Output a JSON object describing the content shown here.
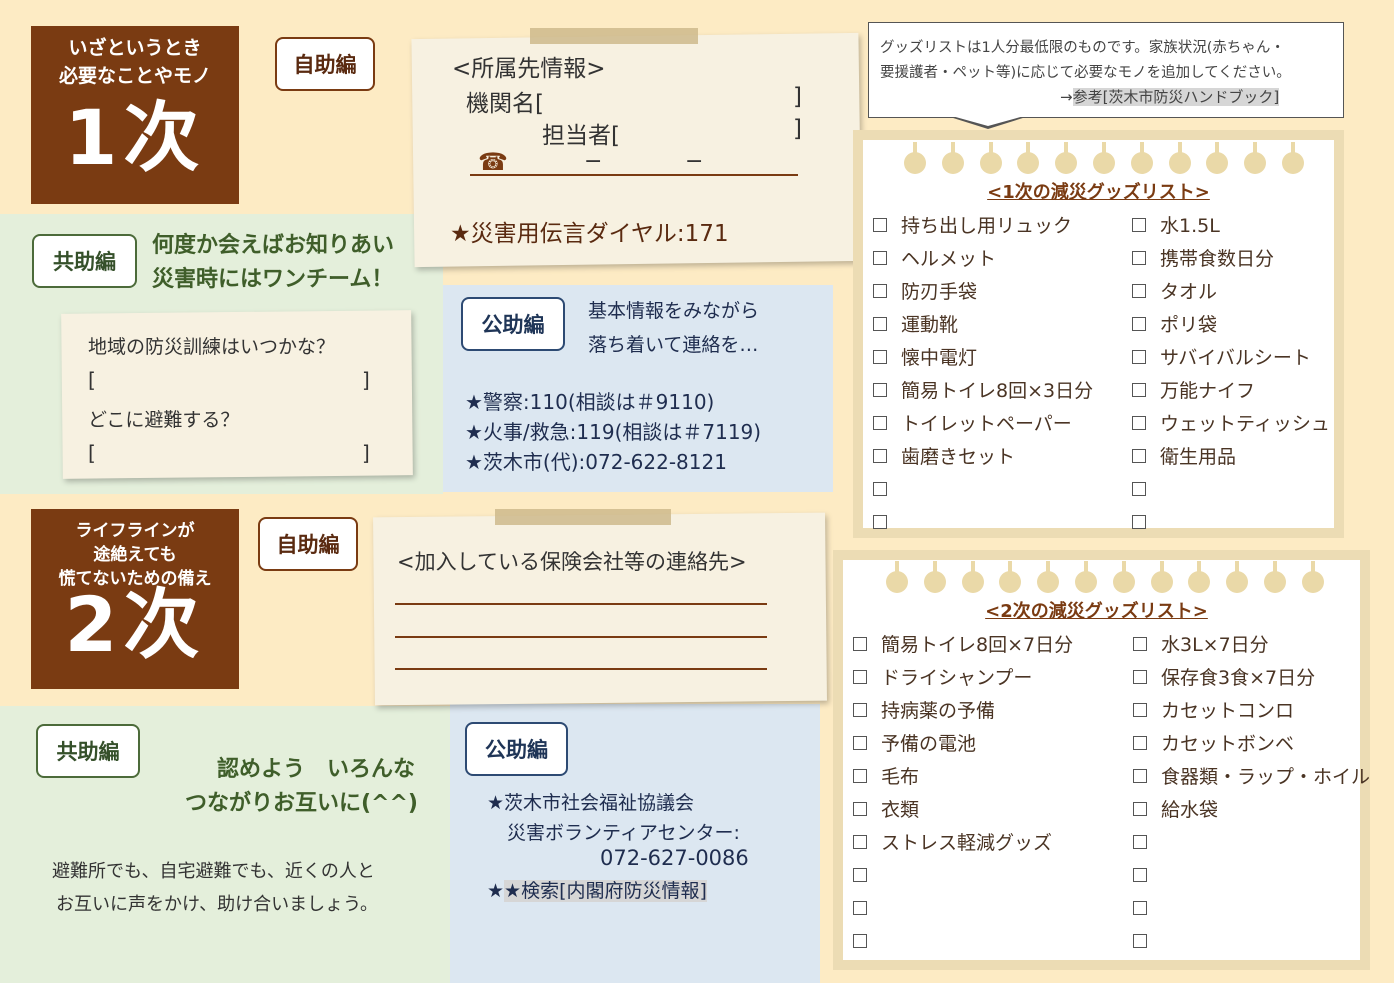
{
  "primary": {
    "heading_line1": "いざというとき",
    "heading_line2": "必要なことやモノ",
    "big": "1次",
    "self_help": "自助編",
    "affiliation": {
      "title": "<所属先情報>",
      "org_label": "機関名[",
      "org_close": "]",
      "person_label": "担当者[",
      "person_close": "]",
      "phone_icon": "☎",
      "dash1": "−",
      "dash2": "−",
      "dial": "★災害用伝言ダイヤル:171"
    },
    "mutual_help": "共助編",
    "mutual_line1": "何度か会えばお知りあい",
    "mutual_line2": "災害時にはワンチーム！",
    "drill_q1": "地域の防災訓練はいつかな？",
    "bracket_open": "[",
    "bracket_close": "]",
    "drill_q2": "どこに避難する？",
    "public_help": "公助編",
    "public_line1": "基本情報をみながら",
    "public_line2": "落ち着いて連絡を…",
    "contacts": [
      "★警察:110(相談は＃9110)",
      "★火事/救急:119(相談は＃7119)",
      "★茨木市(代):072-622-8121"
    ]
  },
  "secondary": {
    "heading_line1": "ライフラインが",
    "heading_line2": "途絶えても",
    "heading_line3": "慌てないための備え",
    "big": "2次",
    "self_help": "自助編",
    "insurance_title": "<加入している保険会社等の連絡先>",
    "mutual_help": "共助編",
    "mutual_line1": "認めよう　いろんな",
    "mutual_line2": "つながりお互いに(^^)",
    "body_line1": "避難所でも、自宅避難でも、近くの人と",
    "body_line2": "お互いに声をかけ、助け合いましょう。",
    "public_help": "公助編",
    "council": "★茨木市社会福祉協議会",
    "volunteer": "災害ボランティアセンター:",
    "volunteer_phone": "072-627-0086",
    "search": "★検索[内閣府防災情報]"
  },
  "notice": {
    "line1": "グッズリストは1人分最低限のものです。家族状況(赤ちゃん・",
    "line2": "要援護者・ペット等)に応じて必要なモノを追加してください。",
    "ref_arrow": "→",
    "ref_text": "参考[茨木市防災ハンドブック]"
  },
  "list1": {
    "title": "<1次の減災グッズリスト>",
    "col1": [
      "持ち出し用リュック",
      "ヘルメット",
      "防刃手袋",
      "運動靴",
      "懐中電灯",
      "簡易トイレ8回×3日分",
      "トイレットペーパー",
      "歯磨きセット",
      "",
      ""
    ],
    "col2": [
      "水1.5L",
      "携帯食数日分",
      "タオル",
      "ポリ袋",
      "サバイバルシート",
      "万能ナイフ",
      "ウェットティッシュ",
      "衛生用品",
      "",
      ""
    ]
  },
  "list2": {
    "title": "<2次の減災グッズリスト>",
    "col1": [
      "簡易トイレ8回×7日分",
      "ドライシャンプー",
      "持病薬の予備",
      "予備の電池",
      "毛布",
      "衣類",
      "ストレス軽減グッズ",
      "",
      "",
      ""
    ],
    "col2": [
      "水3L×7日分",
      "保存食3食×7日分",
      "カセットコンロ",
      "カセットボンベ",
      "食器類・ラップ・ホイル",
      "給水袋",
      "",
      "",
      "",
      ""
    ]
  }
}
